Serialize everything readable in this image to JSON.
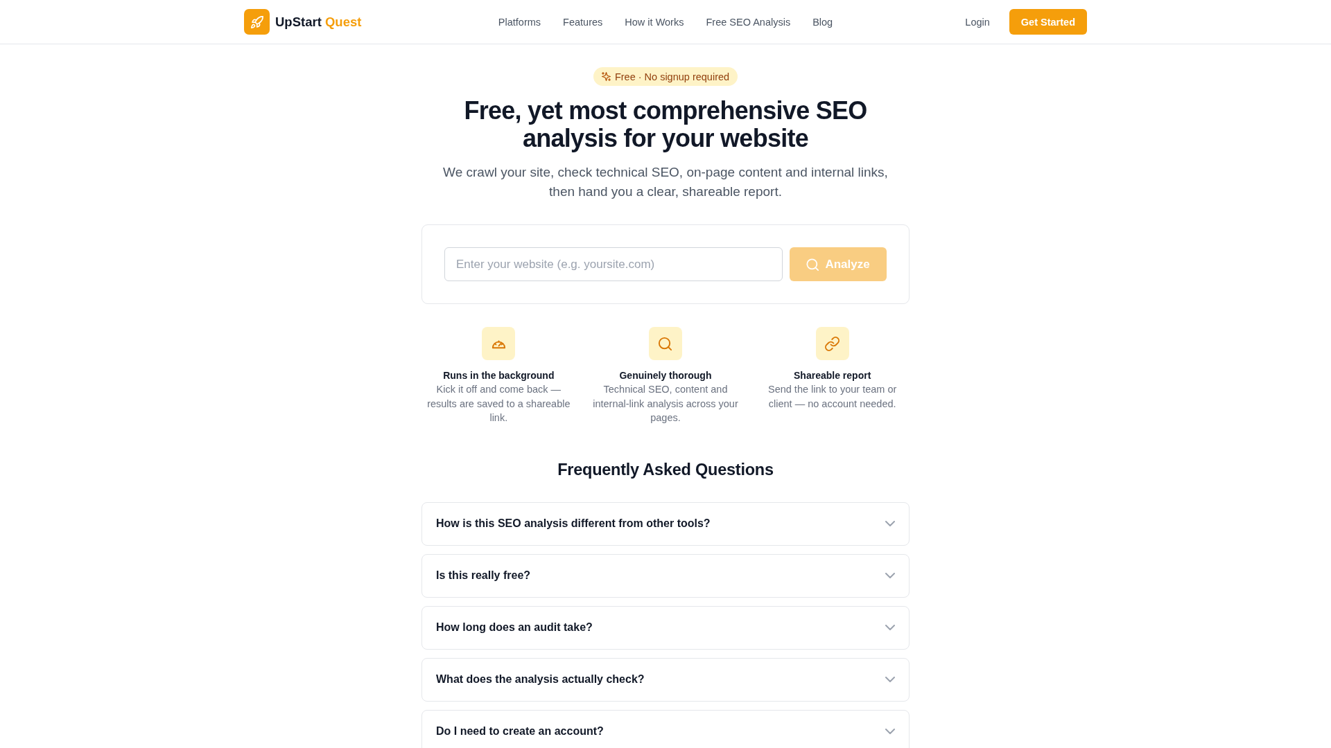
{
  "header": {
    "logo": {
      "name": "UpStart",
      "accent": "Quest"
    },
    "nav": [
      "Platforms",
      "Features",
      "How it Works",
      "Free SEO Analysis",
      "Blog"
    ],
    "login": "Login",
    "cta": "Get Started"
  },
  "hero": {
    "badge": "Free · No signup required",
    "title": "Free, yet most comprehensive SEO analysis for your website",
    "subtitle": "We crawl your site, check technical SEO, on-page content and internal links, then hand you a clear, shareable report."
  },
  "search": {
    "placeholder": "Enter your website (e.g. yoursite.com)",
    "button": {
      "label": "Analyze",
      "disabled": true
    }
  },
  "features": [
    {
      "title": "Runs in the background",
      "text": "Kick it off and come back — results are saved to a shareable link."
    },
    {
      "title": "Genuinely thorough",
      "text": "Technical SEO, content and internal-link analysis across your pages."
    },
    {
      "title": "Shareable report",
      "text": "Send the link to your team or client — no account needed."
    }
  ],
  "faq": {
    "title": "Frequently Asked Questions",
    "items": [
      {
        "question": "How is this SEO analysis different from other tools?",
        "expanded": false
      },
      {
        "question": "Is this really free?",
        "expanded": false
      },
      {
        "question": "How long does an audit take?",
        "expanded": false
      },
      {
        "question": "What does the analysis actually check?",
        "expanded": false
      },
      {
        "question": "Do I need to create an account?",
        "expanded": false
      }
    ]
  }
}
